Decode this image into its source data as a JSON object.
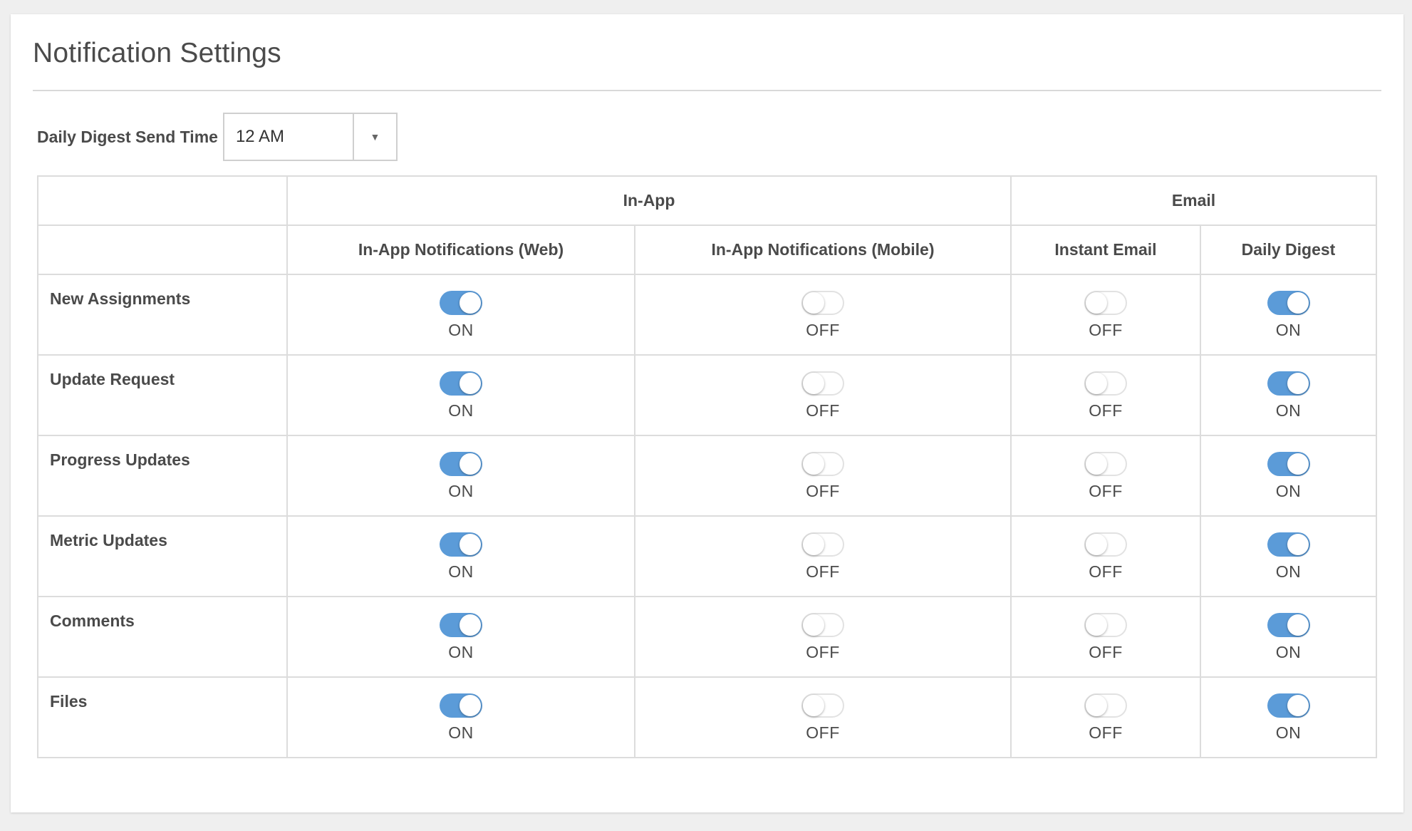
{
  "page": {
    "title": "Notification Settings"
  },
  "digest": {
    "label": "Daily Digest Send Time",
    "value": "12 AM"
  },
  "table": {
    "group_headers": [
      "In-App",
      "Email"
    ],
    "column_headers": [
      "In-App Notifications (Web)",
      "In-App Notifications (Mobile)",
      "Instant Email",
      "Daily Digest"
    ],
    "rows": [
      {
        "label": "New Assignments",
        "settings": [
          true,
          false,
          false,
          true
        ]
      },
      {
        "label": "Update Request",
        "settings": [
          true,
          false,
          false,
          true
        ]
      },
      {
        "label": "Progress Updates",
        "settings": [
          true,
          false,
          false,
          true
        ]
      },
      {
        "label": "Metric Updates",
        "settings": [
          true,
          false,
          false,
          true
        ]
      },
      {
        "label": "Comments",
        "settings": [
          true,
          false,
          false,
          true
        ]
      },
      {
        "label": "Files",
        "settings": [
          true,
          false,
          false,
          true
        ]
      }
    ],
    "on_label": "ON",
    "off_label": "OFF"
  },
  "colors": {
    "toggle_on": "#5b9bd8",
    "toggle_off_border": "#e2e2e2"
  },
  "icons": {
    "select_arrow": "triangle-down-icon"
  }
}
